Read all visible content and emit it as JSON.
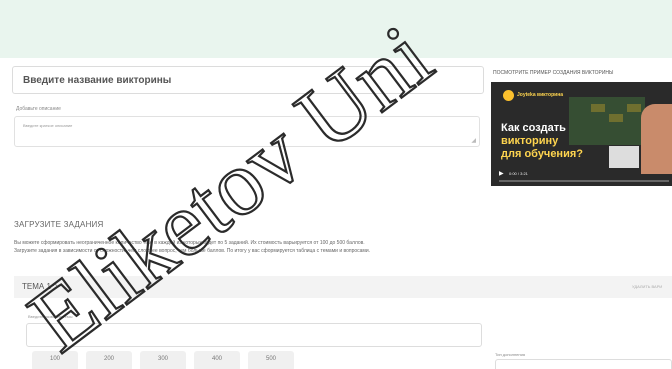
{
  "form": {
    "title_value": "Введите название викторины",
    "description_label": "Добавьте описание",
    "description_placeholder": "Введите краткое описание"
  },
  "upload": {
    "heading": "ЗАГРУЗИТЕ ЗАДАНИЯ",
    "text": "Вы можете сформировать неограниченное количество тем, в каждой из которых будет по 5 заданий. Их стоимость варьируется от 100 до 500 баллов. Загрузите задания в зависимости от сложности: чем сложнее вопрос, тем больше баллов. По итогу у вас сформируется таблица с темами и вопросами."
  },
  "theme": {
    "title": "ТЕМА 1 ^",
    "delete_label": "УДАЛИТЬ ВАРИ",
    "name_label": "Введите название темы",
    "points": [
      "100",
      "200",
      "300",
      "400",
      "500"
    ],
    "extra_label": "Тип дополнения"
  },
  "video": {
    "heading": "ПОСМОТРИТЕ ПРИМЕР СОЗДАНИЯ ВИКТОРИНЫ",
    "brand": "Joyteka викторина",
    "line1": "Как создать",
    "line2": "викторину",
    "line3": "для обучения?",
    "time": "0:00 / 3:21",
    "progress": 0
  },
  "watermark": "Eliketov Uni",
  "colors": {
    "topbar": "#e9f5ee",
    "video_title": "#ffd54f",
    "progress": "#e53935"
  }
}
